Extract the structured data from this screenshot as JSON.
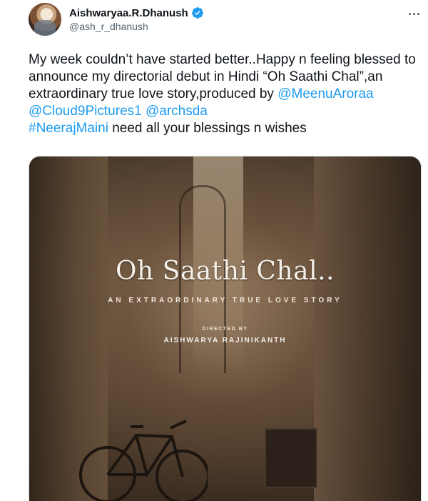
{
  "author": {
    "display_name": "Aishwaryaa.R.Dhanush",
    "handle": "@ash_r_dhanush",
    "verified": true
  },
  "tweet": {
    "text_parts": [
      {
        "type": "text",
        "value": "My week couldn’t have started better..Happy n feeling blessed to announce my directorial debut in Hindi “Oh Saathi Chal”,an extraordinary true love story,produced by "
      },
      {
        "type": "mention",
        "value": "@MeenuAroraa"
      },
      {
        "type": "text",
        "value": " "
      },
      {
        "type": "mention",
        "value": "@Cloud9Pictures1"
      },
      {
        "type": "text",
        "value": " "
      },
      {
        "type": "mention",
        "value": "@archsda"
      },
      {
        "type": "text",
        "value": " "
      },
      {
        "type": "hashtag",
        "value": "#NeerajMaini"
      },
      {
        "type": "text",
        "value": " need all your blessings n wishes"
      }
    ]
  },
  "poster": {
    "title": "Oh Saathi Chal..",
    "tagline": "AN EXTRAORDINARY TRUE LOVE STORY",
    "directed_by_label": "DIRECTED BY",
    "director": "AISHWARYA RAJINIKANTH"
  },
  "colors": {
    "link": "#1d9bf0",
    "verified": "#1d9bf0",
    "text": "#0f1419",
    "secondary": "#536471"
  },
  "icons": {
    "verified": "verified-badge-icon",
    "more": "more-options-icon"
  }
}
